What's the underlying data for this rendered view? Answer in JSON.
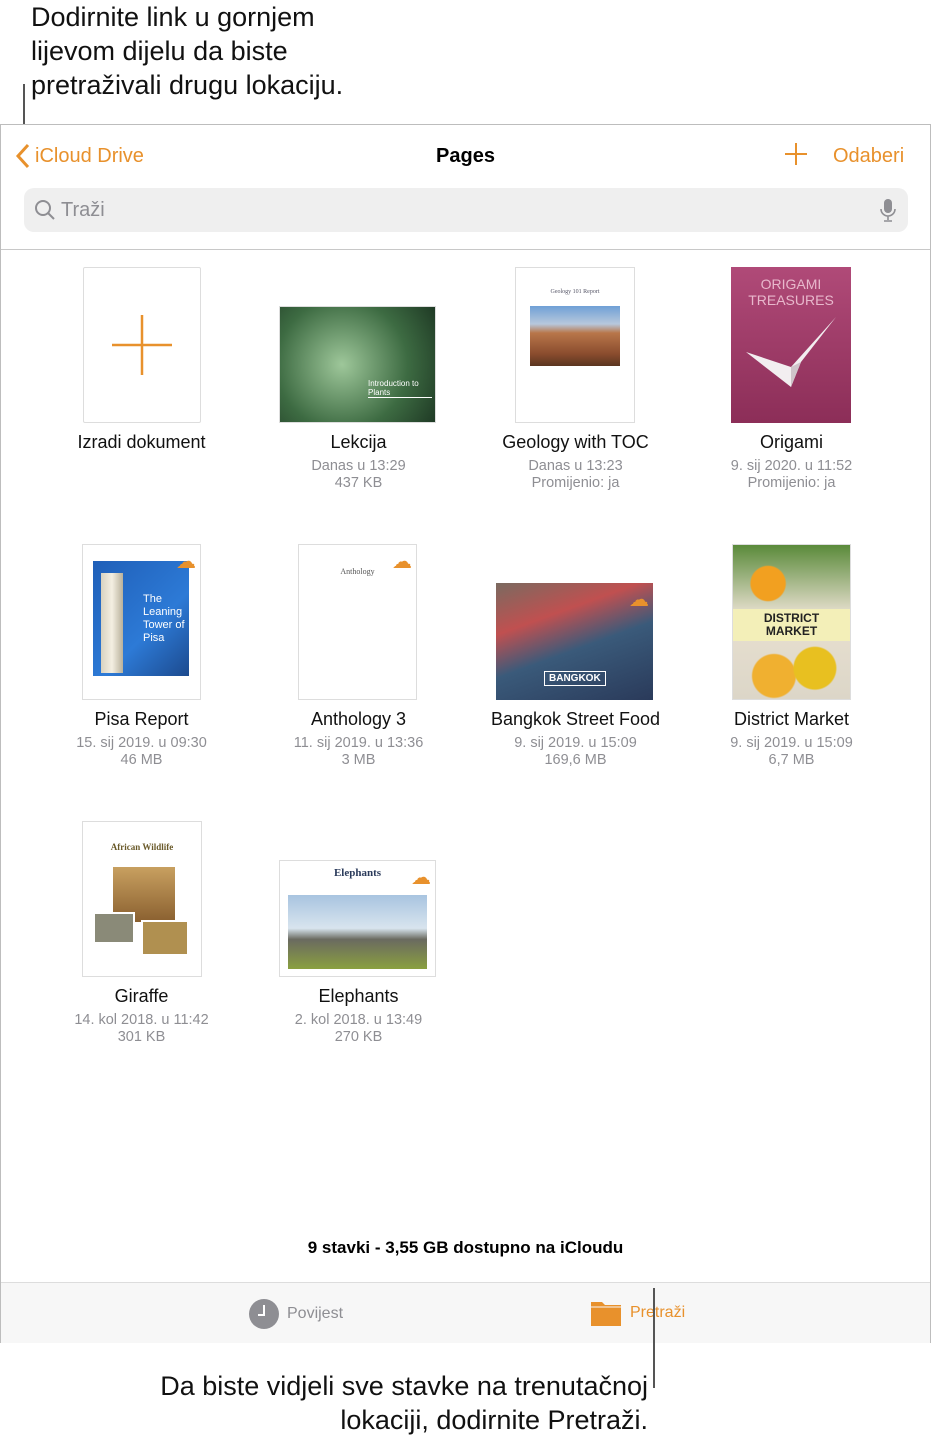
{
  "callouts": {
    "top": [
      "Dodirnite link u gornjem",
      "lijevom dijelu da biste",
      "pretraživali drugu lokaciju."
    ],
    "bottom": [
      "Da biste vidjeli sve stavke na trenutačnoj",
      "lokaciji, dodirnite Pretraži."
    ]
  },
  "nav": {
    "back_label": "iCloud Drive",
    "title": "Pages",
    "select_label": "Odaberi"
  },
  "search": {
    "placeholder": "Traži"
  },
  "create": {
    "label": "Izradi dokument"
  },
  "files": [
    {
      "name": "Lekcija",
      "line1": "Danas u 13:29",
      "line2": "437 KB",
      "cover": "Introduction to Plants",
      "cloud": false
    },
    {
      "name": "Geology with TOC",
      "line1": "Danas u 13:23",
      "line2": "Promijenio: ja",
      "cover": "Geology 101 Report",
      "cloud": false
    },
    {
      "name": "Origami",
      "line1": "9. sij 2020. u 11:52",
      "line2": "Promijenio: ja",
      "cover": "ORIGAMI TREASURES",
      "cloud": false
    },
    {
      "name": "Pisa Report",
      "line1": "15. sij 2019. u 09:30",
      "line2": "46 MB",
      "cover": "The Leaning Tower of Pisa",
      "cloud": true
    },
    {
      "name": "Anthology 3",
      "line1": "11. sij 2019. u 13:36",
      "line2": "3 MB",
      "cover": "Anthology",
      "cloud": true
    },
    {
      "name": "Bangkok Street Food",
      "line1": "9. sij 2019. u 15:09",
      "line2": "169,6 MB",
      "cover": "BANGKOK",
      "cloud": true
    },
    {
      "name": "District Market",
      "line1": "9. sij 2019. u 15:09",
      "line2": "6,7 MB",
      "cover": "DISTRICT MARKET",
      "cloud": false
    },
    {
      "name": "Giraffe",
      "line1": "14. kol 2018. u 11:42",
      "line2": "301 KB",
      "cover": "African Wildlife",
      "cloud": false
    },
    {
      "name": "Elephants",
      "line1": "2. kol 2018. u 13:49",
      "line2": "270 KB",
      "cover": "Elephants",
      "cloud": true
    }
  ],
  "footer": {
    "status": "9 stavki - 3,55 GB dostupno na iCloudu"
  },
  "tabs": [
    {
      "label": "Povijest",
      "icon": "clock-icon"
    },
    {
      "label": "Pretraži",
      "icon": "folder-icon",
      "active": true
    }
  ],
  "colors": {
    "accent": "#e8912c",
    "secondary_text": "#8e8e93"
  }
}
